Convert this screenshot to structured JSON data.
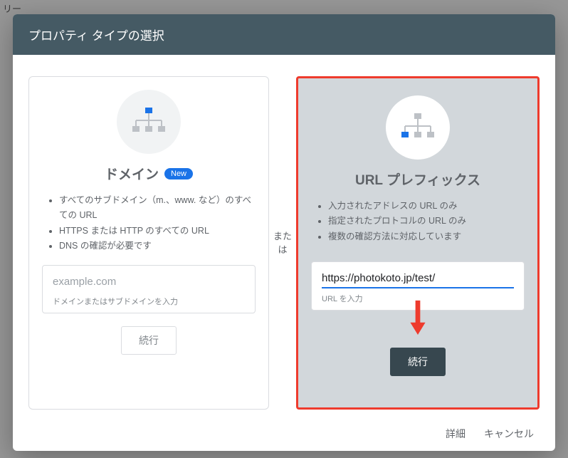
{
  "bg_partial_text": "リー",
  "header": {
    "title": "プロパティ タイプの選択"
  },
  "divider": {
    "line1": "また",
    "line2": "は"
  },
  "left_card": {
    "title": "ドメイン",
    "badge": "New",
    "features": [
      "すべてのサブドメイン（m.、www. など）のすべての URL",
      "HTTPS または HTTP のすべての URL",
      "DNS の確認が必要です"
    ],
    "placeholder": "example.com",
    "help": "ドメインまたはサブドメインを入力",
    "button": "続行"
  },
  "right_card": {
    "title": "URL プレフィックス",
    "features": [
      "入力されたアドレスの URL のみ",
      "指定されたプロトコルの URL のみ",
      "複数の確認方法に対応しています"
    ],
    "value": "https://photokoto.jp/test/",
    "help": "URL を入力",
    "button": "続行"
  },
  "footer": {
    "details": "詳細",
    "cancel": "キャンセル"
  },
  "colors": {
    "accent": "#1a73e8",
    "highlight_border": "#ee3b2d",
    "header_bg": "#455a64"
  }
}
